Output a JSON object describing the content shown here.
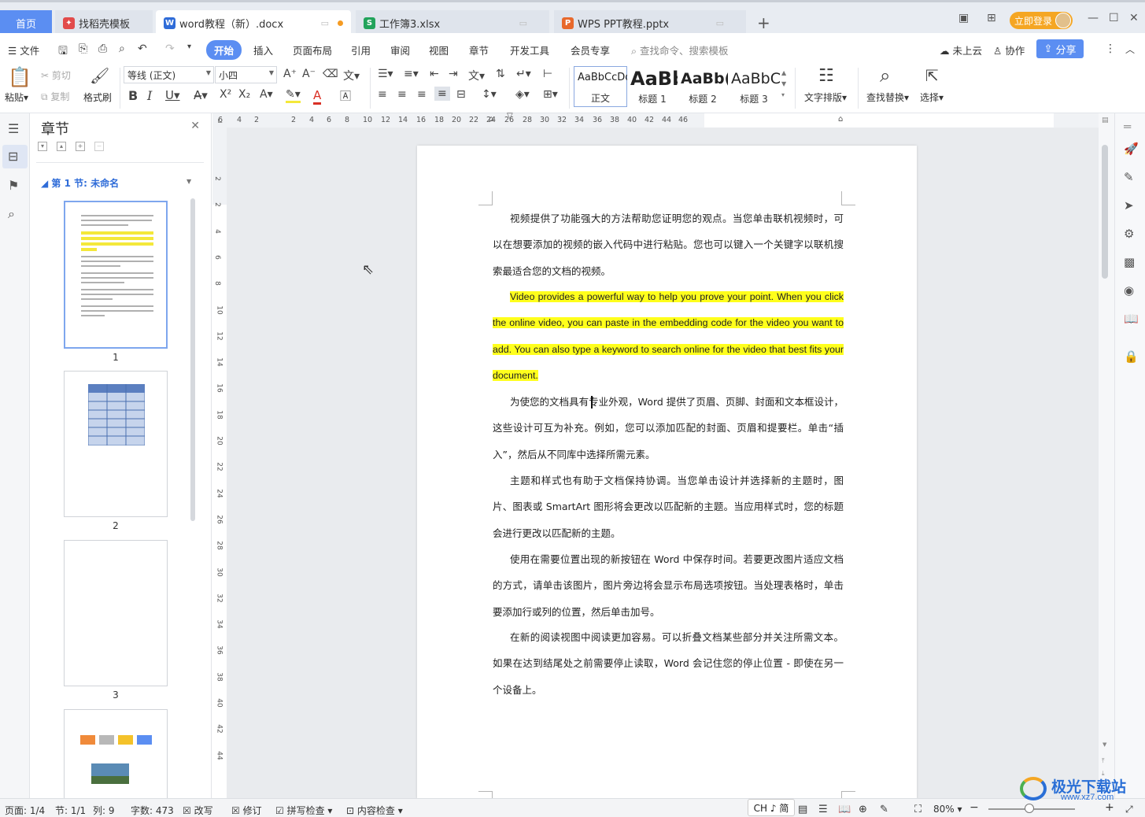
{
  "tabs": {
    "home": "首页",
    "t1": "找稻壳模板",
    "t2": "word教程（新）.docx",
    "t3": "工作簿3.xlsx",
    "t4": "WPS PPT教程.pptx",
    "login": "立即登录"
  },
  "menu": {
    "file": "文件",
    "items": [
      "开始",
      "插入",
      "页面布局",
      "引用",
      "审阅",
      "视图",
      "章节",
      "开发工具",
      "会员专享"
    ],
    "search": "查找命令、搜索模板",
    "cloud": "未上云",
    "collab": "协作",
    "share": "分享"
  },
  "ribbon": {
    "paste": "粘贴",
    "cut": "剪切",
    "copy": "复制",
    "format_painter": "格式刷",
    "font": "等线 (正文)",
    "size": "小四",
    "styles": [
      {
        "sample": "AaBbCcDd",
        "name": "正文"
      },
      {
        "sample": "AaBb",
        "name": "标题 1"
      },
      {
        "sample": "AaBb(",
        "name": "标题 2"
      },
      {
        "sample": "AaBbC",
        "name": "标题 3"
      }
    ],
    "text_layout": "文字排版",
    "find_replace": "查找替换",
    "select": "选择"
  },
  "nav": {
    "title": "章节",
    "section": "第 1 节: 未命名",
    "pages": [
      "1",
      "2",
      "3"
    ]
  },
  "ruler": {
    "h": [
      "6",
      "4",
      "2",
      "2",
      "4",
      "6",
      "8",
      "10",
      "12",
      "14",
      "16",
      "18",
      "20",
      "22",
      "24",
      "26",
      "28",
      "30",
      "32",
      "34",
      "36",
      "38",
      "40",
      "42",
      "44",
      "46"
    ],
    "v": [
      "2",
      "2",
      "4",
      "6",
      "8",
      "10",
      "12",
      "14",
      "16",
      "18",
      "20",
      "22",
      "24",
      "26",
      "28",
      "30",
      "32",
      "34",
      "36",
      "38",
      "40",
      "42",
      "44"
    ]
  },
  "document": {
    "p1": "视频提供了功能强大的方法帮助您证明您的观点。当您单击联机视频时，可以在想要添加的视频的嵌入代码中进行粘贴。您也可以键入一个关键字以联机搜索最适合您的文档的视频。",
    "p2": "Video provides a powerful way to help you prove your point. When you click the online video, you can paste in the embedding code for the video you want to add. You can also type a keyword to search online for the video that best fits your document.",
    "p3": "为使您的文档具有专业外观，Word 提供了页眉、页脚、封面和文本框设计，这些设计可互为补充。例如，您可以添加匹配的封面、页眉和提要栏。单击“插入”，然后从不同库中选择所需元素。",
    "p4": "主题和样式也有助于文档保持协调。当您单击设计并选择新的主题时，图片、图表或 SmartArt 图形将会更改以匹配新的主题。当应用样式时，您的标题会进行更改以匹配新的主题。",
    "p5": "使用在需要位置出现的新按钮在 Word 中保存时间。若要更改图片适应文档的方式，请单击该图片，图片旁边将会显示布局选项按钮。当处理表格时，单击要添加行或列的位置，然后单击加号。",
    "p6": "在新的阅读视图中阅读更加容易。可以折叠文档某些部分并关注所需文本。如果在达到结尾处之前需要停止读取，Word 会记住您的停止位置 - 即使在另一个设备上。"
  },
  "status": {
    "page": "页面: 1/4",
    "section": "节: 1/1",
    "col": "列: 9",
    "words": "字数: 473",
    "overtype": "改写",
    "revise": "修订",
    "spell": "拼写检查",
    "content_check": "内容检查",
    "ime": "CH ♪ 简",
    "zoom": "80%"
  },
  "watermark": {
    "text": "极光下载站",
    "url": "www.xz7.com"
  },
  "colors": {
    "accent": "#5b8ef2",
    "highlight": "#ffff1c",
    "login": "#f5a623"
  }
}
